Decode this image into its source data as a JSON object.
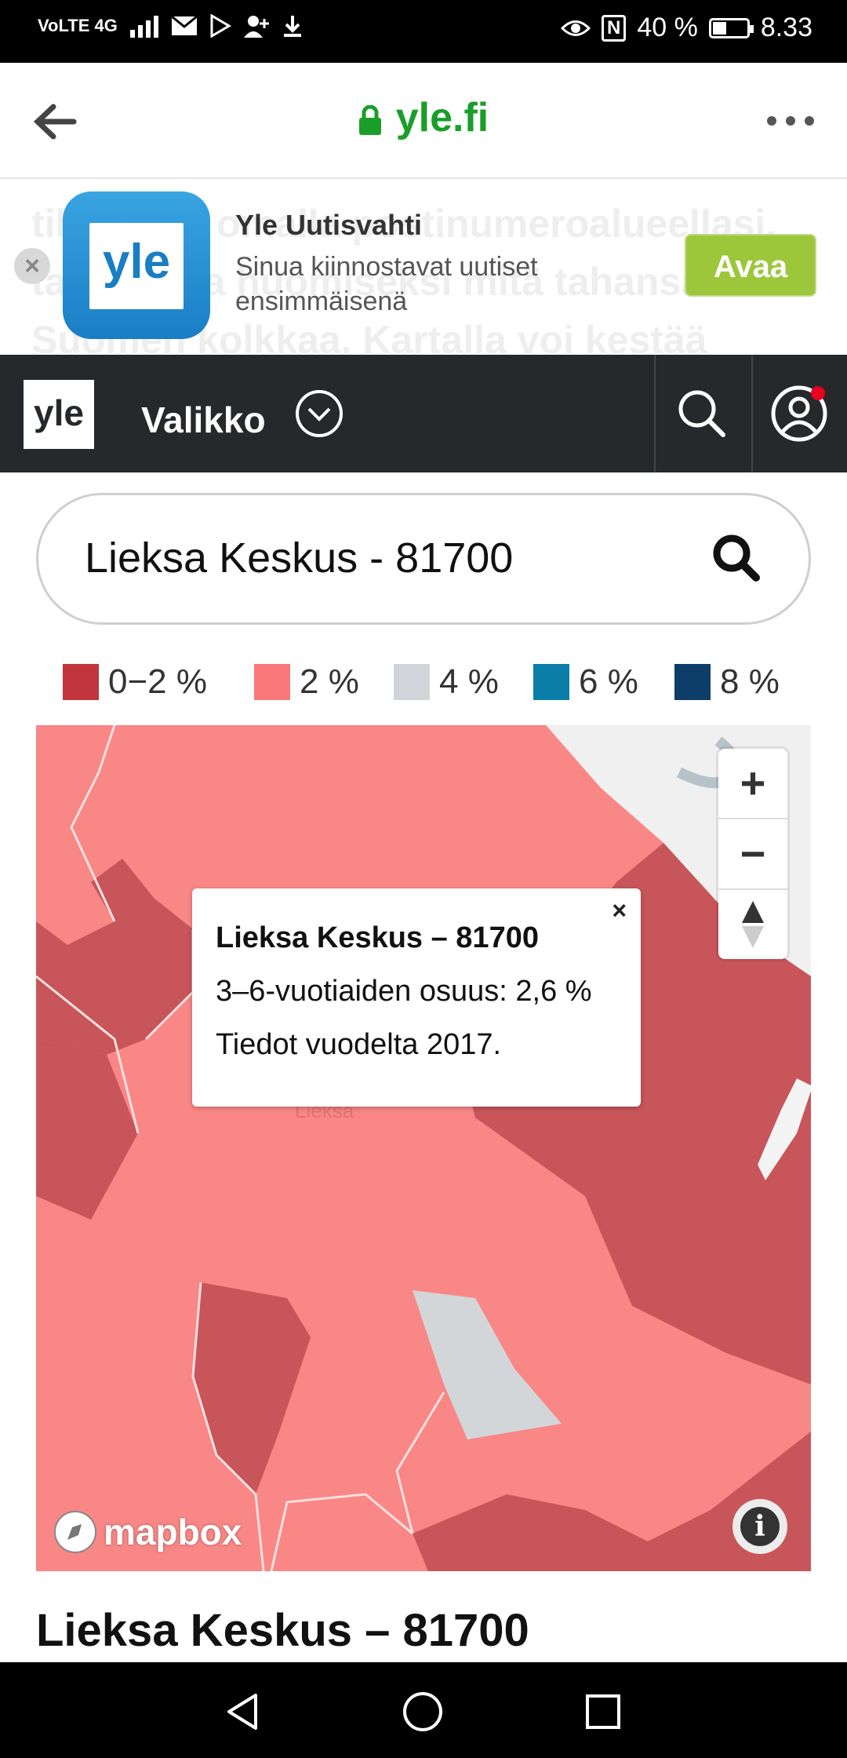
{
  "status_bar": {
    "network": "VoLTE 4G",
    "nfc": "N",
    "battery": "40 %",
    "battery_level": 0.4,
    "time": "8.33"
  },
  "browser": {
    "url": "yle.fi"
  },
  "smart_banner": {
    "background_text": "tilastointi omalla postinumeroalueellasi. tarkastella huomiseksi mitä tahansa Suomen kolkkaa. Kartalla voi kestää",
    "app_icon_text": "yle",
    "app_title": "Yle Uutisvahti",
    "app_subtitle": "Sinua kiinnostavat uutiset ensimmäisenä",
    "open_label": "Avaa"
  },
  "nav": {
    "logo": "yle",
    "menu_label": "Valikko"
  },
  "search": {
    "value": "Lieksa Keskus - 81700"
  },
  "legend": [
    {
      "label": "0−2 %",
      "color": "#c1343c"
    },
    {
      "label": "2 %",
      "color": "#f97879"
    },
    {
      "label": "4 %",
      "color": "#d1d5d9"
    },
    {
      "label": "6 %",
      "color": "#0a7ea8"
    },
    {
      "label": "8 %",
      "color": "#0d3e6a"
    }
  ],
  "map": {
    "town_label": "Lieksa",
    "zoom_in": "+",
    "zoom_out": "−",
    "attribution": "mapbox",
    "info": "i",
    "popup": {
      "close": "×",
      "title": "Lieksa Keskus – 81700",
      "line1": "3–6-vuotiaiden osuus: 2,6 %",
      "line2": "Tiedot vuodelta 2017."
    }
  },
  "section_heading": "Lieksa Keskus – 81700"
}
